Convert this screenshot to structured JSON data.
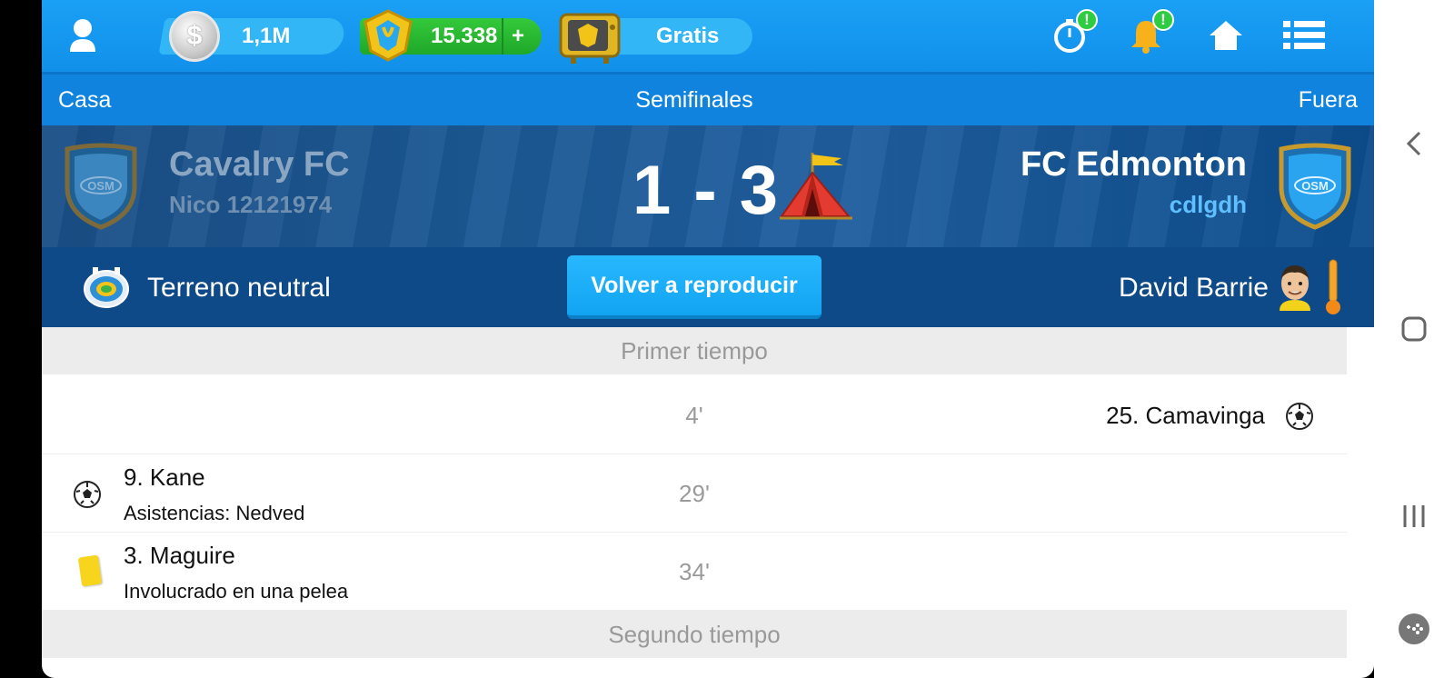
{
  "topbar": {
    "coins": "1,1M",
    "gold": "15.338",
    "gold_plus": "+",
    "tv_label": "Gratis"
  },
  "stagebar": {
    "home": "Casa",
    "stage": "Semifinales",
    "away": "Fuera"
  },
  "match": {
    "home_team": "Cavalry FC",
    "home_manager": "Nico 12121974",
    "score": "1 - 3",
    "away_team": "FC Edmonton",
    "away_manager": "cdlgdh"
  },
  "info": {
    "venue": "Terreno neutral",
    "replay_label": "Volver a reproducir",
    "referee": "David Barrie"
  },
  "first_half": "Primer tiempo",
  "events": [
    {
      "minute": "4'",
      "side": "away",
      "type": "goal",
      "player": "25. Camavinga"
    },
    {
      "minute": "29'",
      "side": "home",
      "type": "goal",
      "player": "9. Kane",
      "detail": "Asistencias: Nedved"
    },
    {
      "minute": "34'",
      "side": "home",
      "type": "yellow-card",
      "player": "3. Maguire",
      "detail": "Involucrado en una pelea"
    }
  ],
  "second_half": "Segundo tiempo",
  "colors": {
    "topbar": "#1190ea",
    "stagebar": "#0f83dd",
    "infobar": "#0f4a88",
    "replay_button": "#12a4f2",
    "gold_pill": "#1fa82a",
    "notification_badge": "#2ecc40"
  },
  "icons": [
    "profile-icon",
    "coin-icon",
    "gem-icon",
    "tv-icon",
    "timer-icon",
    "bell-icon",
    "home-icon",
    "menu-icon",
    "crest-icon",
    "tent-icon",
    "stadium-icon",
    "referee-icon",
    "thermometer-icon",
    "ball-icon",
    "yellow-card-icon",
    "back-icon",
    "recents-icon",
    "home-nav-icon",
    "game-icon"
  ]
}
